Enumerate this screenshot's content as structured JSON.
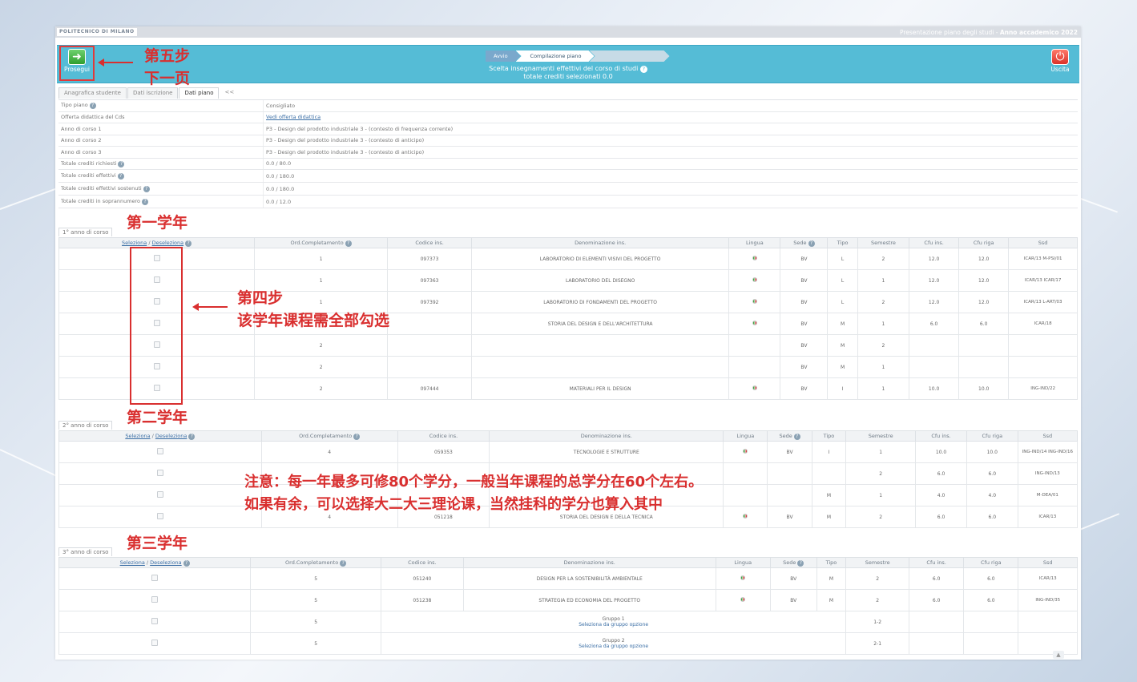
{
  "topbar": {
    "logo": "POLITECNICO DI MILANO",
    "right_prefix": "Presentazione piano degli studi - ",
    "right_bold": "Anno accademico 2022"
  },
  "header": {
    "prosegui_label": "Prosegui",
    "uscita_label": "Uscita",
    "steps": [
      "Avvio",
      "Compilazione piano",
      ""
    ],
    "subtitle_line1": "Scelta insegnamenti effettivi del corso di studi",
    "subtitle_line2": "totale crediti selezionati 0.0"
  },
  "tabs": [
    "Anagrafica studente",
    "Dati iscrizione",
    "Dati piano",
    "<<"
  ],
  "info": [
    {
      "k": "Tipo piano",
      "v": "Consigliato",
      "help": true
    },
    {
      "k": "Offerta didattica del Cds",
      "v": "Vedi offerta didattica",
      "link": true
    },
    {
      "k": "Anno di corso 1",
      "v": "P3 - Design del prodotto industriale 3 - (contesto di frequenza corrente)"
    },
    {
      "k": "Anno di corso 2",
      "v": "P3 - Design del prodotto industriale 3 - (contesto di anticipo)"
    },
    {
      "k": "Anno di corso 3",
      "v": "P3 - Design del prodotto industriale 3 - (contesto di anticipo)"
    },
    {
      "k": "Totale crediti richiesti",
      "v": "0.0 / 80.0",
      "help": true
    },
    {
      "k": "Totale crediti effettivi",
      "v": "0.0 / 180.0",
      "help": true,
      "tall": true
    },
    {
      "k": "Totale crediti effettivi sostenuti",
      "v": "0.0 / 180.0",
      "help": true,
      "tall": true
    },
    {
      "k": "Totale crediti in soprannumero",
      "v": "0.0 / 12.0",
      "help": true,
      "tall": true
    }
  ],
  "table_headers": [
    "Seleziona",
    "Deseleziona",
    "Ord.Completamento",
    "Codice ins.",
    "Denominazione ins.",
    "Lingua",
    "Sede",
    "Tipo",
    "Semestre",
    "Cfu ins.",
    "Cfu riga",
    "Ssd"
  ],
  "years": [
    {
      "title": "1° anno di corso",
      "rows": [
        {
          "ord": "1",
          "code": "097373",
          "name": "LABORATORIO DI ELEMENTI VISIVI DEL PROGETTO",
          "sede": "BV",
          "tipo": "L",
          "sem": "2",
          "cfu": "12.0",
          "cfu_riga": "12.0",
          "ssd": "ICAR/13 M-PSI/01"
        },
        {
          "ord": "1",
          "code": "097363",
          "name": "LABORATORIO DEL DISEGNO",
          "sede": "BV",
          "tipo": "L",
          "sem": "1",
          "cfu": "12.0",
          "cfu_riga": "12.0",
          "ssd": "ICAR/13 ICAR/17"
        },
        {
          "ord": "1",
          "code": "097392",
          "name": "LABORATORIO DI FONDAMENTI DEL PROGETTO",
          "sede": "BV",
          "tipo": "L",
          "sem": "2",
          "cfu": "12.0",
          "cfu_riga": "12.0",
          "ssd": "ICAR/13 L-ART/03"
        },
        {
          "ord": "",
          "code": "",
          "name": "STORIA DEL DESIGN E DELL'ARCHITETTURA",
          "sede": "BV",
          "tipo": "M",
          "sem": "1",
          "cfu": "6.0",
          "cfu_riga": "6.0",
          "ssd": "ICAR/18"
        },
        {
          "ord": "2",
          "code": "",
          "name": "",
          "sede": "BV",
          "tipo": "M",
          "sem": "2",
          "cfu": "",
          "cfu_riga": "",
          "ssd": ""
        },
        {
          "ord": "2",
          "code": "",
          "name": "",
          "sede": "BV",
          "tipo": "M",
          "sem": "1",
          "cfu": "",
          "cfu_riga": "",
          "ssd": ""
        },
        {
          "ord": "2",
          "code": "097444",
          "name": "MATERIALI PER IL DESIGN",
          "sede": "BV",
          "tipo": "I",
          "sem": "1",
          "cfu": "10.0",
          "cfu_riga": "10.0",
          "ssd": "ING-IND/22"
        }
      ]
    },
    {
      "title": "2° anno di corso",
      "rows": [
        {
          "ord": "4",
          "code": "059353",
          "name": "TECNOLOGIE E STRUTTURE",
          "sede": "BV",
          "tipo": "I",
          "sem": "1",
          "cfu": "10.0",
          "cfu_riga": "10.0",
          "ssd": "ING-IND/14 ING-IND/16"
        },
        {
          "ord": "",
          "code": "",
          "name": "",
          "sede": "",
          "tipo": "",
          "sem": "2",
          "cfu": "6.0",
          "cfu_riga": "6.0",
          "ssd": "ING-IND/13"
        },
        {
          "ord": "",
          "code": "",
          "name": "",
          "sede": "",
          "tipo": "M",
          "sem": "1",
          "cfu": "4.0",
          "cfu_riga": "4.0",
          "ssd": "M-DEA/01"
        },
        {
          "ord": "4",
          "code": "051218",
          "name": "STORIA DEL DESIGN E DELLA TECNICA",
          "sede": "BV",
          "tipo": "M",
          "sem": "2",
          "cfu": "6.0",
          "cfu_riga": "6.0",
          "ssd": "ICAR/13"
        }
      ]
    },
    {
      "title": "3° anno di corso",
      "rows": [
        {
          "ord": "5",
          "code": "051240",
          "name": "DESIGN PER LA SOSTENIBILITÀ AMBIENTALE",
          "sede": "BV",
          "tipo": "M",
          "sem": "2",
          "cfu": "6.0",
          "cfu_riga": "6.0",
          "ssd": "ICAR/13"
        },
        {
          "ord": "5",
          "code": "051238",
          "name": "STRATEGIA ED ECONOMIA DEL PROGETTO",
          "sede": "BV",
          "tipo": "M",
          "sem": "2",
          "cfu": "6.0",
          "cfu_riga": "6.0",
          "ssd": "ING-IND/35"
        },
        {
          "ord": "5",
          "group": "Gruppo 1",
          "group_link": "Seleziona da gruppo opzione",
          "sem": "1-2"
        },
        {
          "ord": "5",
          "group": "Gruppo 2",
          "group_link": "Seleziona da gruppo opzione",
          "sem": "2-1"
        }
      ]
    }
  ],
  "annotations": {
    "step5_line1": "第五步",
    "step5_line2": "下一页",
    "year1": "第一学年",
    "step4_line1": "第四步",
    "step4_line2": "该学年课程需全部勾选",
    "year2": "第二学年",
    "note_line1": "注意：每一年最多可修80个学分，一般当年课程的总学分在60个左右。",
    "note_line2": "如果有余，可以选择大二大三理论课，当然挂科的学分也算入其中",
    "year3": "第三学年"
  },
  "colors": {
    "header_bg": "#55bcd6",
    "annotation_red": "#d92f2f"
  },
  "icons": {
    "prosegui": "arrow-right-icon",
    "uscita": "power-icon",
    "help": "question-icon",
    "flag": "italian-flag-icon"
  }
}
